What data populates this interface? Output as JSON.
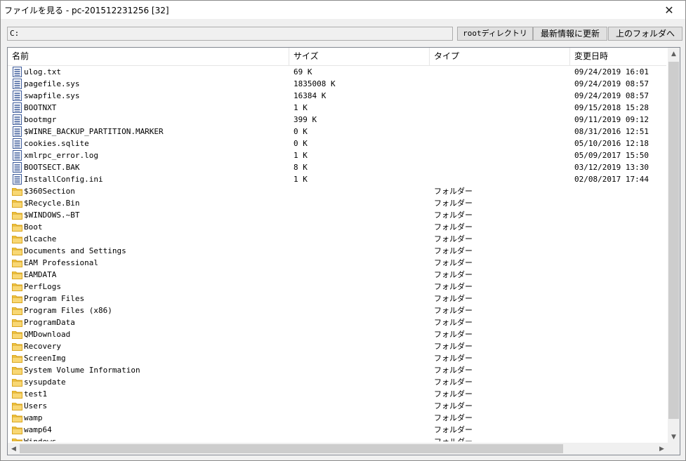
{
  "window": {
    "title": "ファイルを見る - pc-201512231256 [32]",
    "close_label": "✕"
  },
  "toolbar": {
    "path_value": "C:",
    "root_label": "rootディレクトリ",
    "refresh_label": "最新情報に更新",
    "up_label": "上のフォルダへ"
  },
  "columns": {
    "name": "名前",
    "size": "サイズ",
    "type": "タイプ",
    "date": "変更日時"
  },
  "icons": {
    "file": "file-icon",
    "folder": "folder-icon"
  },
  "colors": {
    "file_icon": "#3c5a9a",
    "folder_icon": "#f3c946"
  },
  "files": [
    {
      "name": "ulog.txt",
      "size": "69 K",
      "type": "",
      "date": "09/24/2019 16:01"
    },
    {
      "name": "pagefile.sys",
      "size": "1835008 K",
      "type": "",
      "date": "09/24/2019 08:57"
    },
    {
      "name": "swapfile.sys",
      "size": "16384 K",
      "type": "",
      "date": "09/24/2019 08:57"
    },
    {
      "name": "BOOTNXT",
      "size": "1 K",
      "type": "",
      "date": "09/15/2018 15:28"
    },
    {
      "name": "bootmgr",
      "size": "399 K",
      "type": "",
      "date": "09/11/2019 09:12"
    },
    {
      "name": "$WINRE_BACKUP_PARTITION.MARKER",
      "size": "0 K",
      "type": "",
      "date": "08/31/2016 12:51"
    },
    {
      "name": "cookies.sqlite",
      "size": "0 K",
      "type": "",
      "date": "05/10/2016 12:18"
    },
    {
      "name": "xmlrpc_error.log",
      "size": "1 K",
      "type": "",
      "date": "05/09/2017 15:50"
    },
    {
      "name": "BOOTSECT.BAK",
      "size": "8 K",
      "type": "",
      "date": "03/12/2019 13:30"
    },
    {
      "name": "InstallConfig.ini",
      "size": "1 K",
      "type": "",
      "date": "02/08/2017 17:44"
    }
  ],
  "folders": [
    {
      "name": "$360Section",
      "type": "フォルダー"
    },
    {
      "name": "$Recycle.Bin",
      "type": "フォルダー"
    },
    {
      "name": "$WINDOWS.~BT",
      "type": "フォルダー"
    },
    {
      "name": "Boot",
      "type": "フォルダー"
    },
    {
      "name": "dlcache",
      "type": "フォルダー"
    },
    {
      "name": "Documents and Settings",
      "type": "フォルダー"
    },
    {
      "name": "EAM Professional",
      "type": "フォルダー"
    },
    {
      "name": "EAMDATA",
      "type": "フォルダー"
    },
    {
      "name": "PerfLogs",
      "type": "フォルダー"
    },
    {
      "name": "Program Files",
      "type": "フォルダー"
    },
    {
      "name": "Program Files (x86)",
      "type": "フォルダー"
    },
    {
      "name": "ProgramData",
      "type": "フォルダー"
    },
    {
      "name": "QMDownload",
      "type": "フォルダー"
    },
    {
      "name": "Recovery",
      "type": "フォルダー"
    },
    {
      "name": "ScreenImg",
      "type": "フォルダー"
    },
    {
      "name": "System Volume Information",
      "type": "フォルダー"
    },
    {
      "name": "sysupdate",
      "type": "フォルダー"
    },
    {
      "name": "test1",
      "type": "フォルダー"
    },
    {
      "name": "Users",
      "type": "フォルダー"
    },
    {
      "name": "wamp",
      "type": "フォルダー"
    },
    {
      "name": "wamp64",
      "type": "フォルダー"
    },
    {
      "name": "Windows",
      "type": "フォルダー"
    }
  ]
}
